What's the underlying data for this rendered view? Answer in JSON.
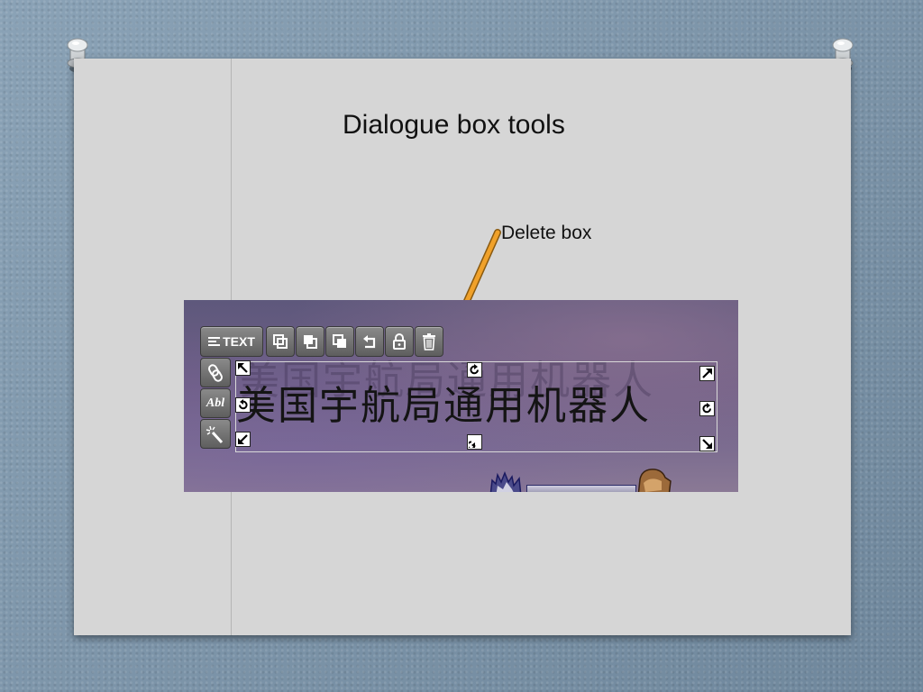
{
  "slide": {
    "title": "Dialogue box tools",
    "callout_label": "Delete box",
    "accent_color": "#f0a12a"
  },
  "screenshot": {
    "toolbar": {
      "text_button_label": "TEXT",
      "icons": [
        "bring-forward-icon",
        "bring-to-front-icon",
        "send-backward-icon",
        "undo-icon",
        "lock-icon",
        "trash-icon"
      ]
    },
    "side_tools": {
      "abl_label": "Abl",
      "icons": [
        "link-icon",
        "text-style-icon",
        "magic-wand-icon"
      ]
    },
    "text_box": {
      "text": "美国宇航局通用机器人"
    },
    "handles": [
      "resize-nw-icon",
      "rotate-top-icon",
      "resize-ne-icon",
      "rotate-left-icon",
      "rotate-right-icon",
      "resize-sw-icon",
      "rotate-bottom-icon",
      "resize-se-icon"
    ]
  }
}
